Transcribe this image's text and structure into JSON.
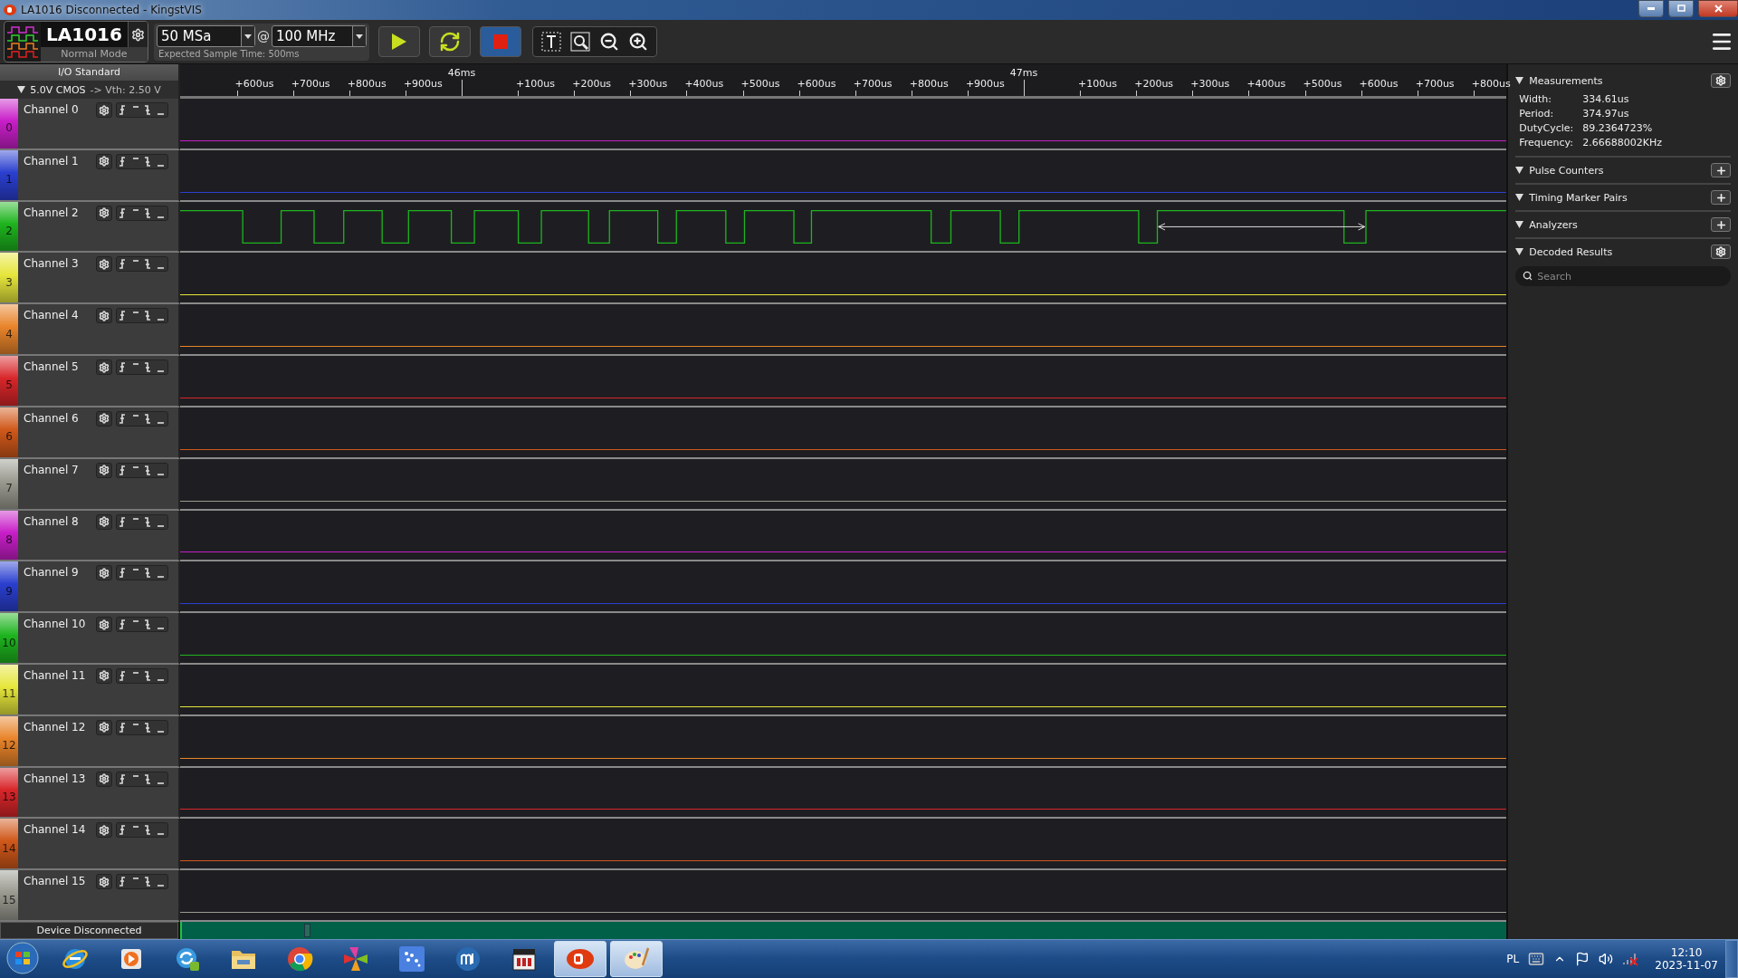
{
  "window": {
    "title": "LA1016 Disconnected - KingstVIS"
  },
  "device": {
    "name": "LA1016",
    "mode": "Normal Mode"
  },
  "sampling": {
    "depth": "50 MSa",
    "separator": "@",
    "rate": "100 MHz",
    "expected_time": "Expected Sample Time: 500ms"
  },
  "io_standard": {
    "title": "I/O Standard",
    "value": "5.0V CMOS",
    "threshold": "-> Vth: 2.50 V"
  },
  "ruler": {
    "ticks": [
      {
        "label": "+600us",
        "kind": "minor"
      },
      {
        "label": "+700us",
        "kind": "minor"
      },
      {
        "label": "+800us",
        "kind": "minor"
      },
      {
        "label": "+900us",
        "kind": "minor"
      },
      {
        "label": "46ms",
        "kind": "major"
      },
      {
        "label": "+100us",
        "kind": "minor"
      },
      {
        "label": "+200us",
        "kind": "minor"
      },
      {
        "label": "+300us",
        "kind": "minor"
      },
      {
        "label": "+400us",
        "kind": "minor"
      },
      {
        "label": "+500us",
        "kind": "minor"
      },
      {
        "label": "+600us",
        "kind": "minor"
      },
      {
        "label": "+700us",
        "kind": "minor"
      },
      {
        "label": "+800us",
        "kind": "minor"
      },
      {
        "label": "+900us",
        "kind": "minor"
      },
      {
        "label": "47ms",
        "kind": "major"
      },
      {
        "label": "+100us",
        "kind": "minor"
      },
      {
        "label": "+200us",
        "kind": "minor"
      },
      {
        "label": "+300us",
        "kind": "minor"
      },
      {
        "label": "+400us",
        "kind": "minor"
      },
      {
        "label": "+500us",
        "kind": "minor"
      },
      {
        "label": "+600us",
        "kind": "minor"
      },
      {
        "label": "+700us",
        "kind": "minor"
      },
      {
        "label": "+800us",
        "kind": "minor"
      }
    ]
  },
  "channels": [
    {
      "name": "Channel 0",
      "number": "0",
      "color": "#c81ec8",
      "kind": "flat"
    },
    {
      "name": "Channel 1",
      "number": "1",
      "color": "#2a3fd0",
      "kind": "flat"
    },
    {
      "name": "Channel 2",
      "number": "2",
      "color": "#1eb41e",
      "kind": "wave"
    },
    {
      "name": "Channel 3",
      "number": "3",
      "color": "#e6e63c",
      "kind": "flat"
    },
    {
      "name": "Channel 4",
      "number": "4",
      "color": "#e8842a",
      "kind": "flat"
    },
    {
      "name": "Channel 5",
      "number": "5",
      "color": "#d8262a",
      "kind": "flat"
    },
    {
      "name": "Channel 6",
      "number": "6",
      "color": "#d0581a",
      "kind": "flat"
    },
    {
      "name": "Channel 7",
      "number": "7",
      "color": "#9a9a90",
      "kind": "flat"
    },
    {
      "name": "Channel 8",
      "number": "8",
      "color": "#c81ec8",
      "kind": "flat"
    },
    {
      "name": "Channel 9",
      "number": "9",
      "color": "#2a3fd0",
      "kind": "flat"
    },
    {
      "name": "Channel 10",
      "number": "10",
      "color": "#1eb41e",
      "kind": "flat"
    },
    {
      "name": "Channel 11",
      "number": "11",
      "color": "#e6e63c",
      "kind": "flat"
    },
    {
      "name": "Channel 12",
      "number": "12",
      "color": "#e8842a",
      "kind": "flat"
    },
    {
      "name": "Channel 13",
      "number": "13",
      "color": "#d8262a",
      "kind": "flat"
    },
    {
      "name": "Channel 14",
      "number": "14",
      "color": "#d0581a",
      "kind": "flat"
    },
    {
      "name": "Channel 15",
      "number": "15",
      "color": "#9a9a90",
      "kind": "flat"
    }
  ],
  "status": "Device Disconnected",
  "panel": {
    "sections": [
      {
        "title": "Measurements",
        "kind": "gear",
        "rows": [
          {
            "label": "Width:",
            "value": "334.61us"
          },
          {
            "label": "Period:",
            "value": "374.97us"
          },
          {
            "label": "DutyCycle:",
            "value": "89.2364723%"
          },
          {
            "label": "Frequency:",
            "value": "2.66688002KHz"
          }
        ]
      },
      {
        "title": "Pulse Counters",
        "kind": "plus"
      },
      {
        "title": "Timing Marker Pairs",
        "kind": "plus"
      },
      {
        "title": "Analyzers",
        "kind": "plus"
      },
      {
        "title": "Decoded Results",
        "kind": "gear",
        "search_placeholder": "Search"
      }
    ]
  },
  "taskbar": {
    "apps": [
      {
        "kind": "ie",
        "selected": false
      },
      {
        "kind": "media",
        "selected": false
      },
      {
        "kind": "sync",
        "selected": false
      },
      {
        "kind": "folder",
        "selected": false
      },
      {
        "kind": "chrome",
        "selected": false
      },
      {
        "kind": "pinwheel",
        "selected": false
      },
      {
        "kind": "dots",
        "selected": false
      },
      {
        "kind": "muse",
        "selected": false
      },
      {
        "kind": "video",
        "selected": false
      },
      {
        "kind": "kingst",
        "selected": true
      },
      {
        "kind": "paint",
        "selected": true
      }
    ],
    "language": "PL",
    "time": "12:10",
    "date": "2023-11-07"
  }
}
